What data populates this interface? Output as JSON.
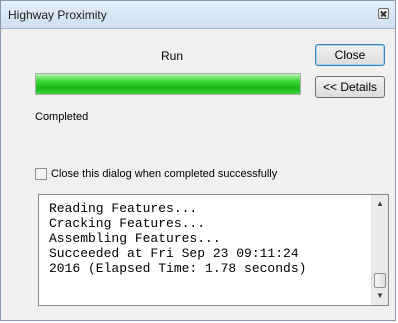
{
  "window": {
    "title": "Highway Proximity",
    "close_icon": "close-x-icon"
  },
  "run_label": "Run",
  "progress": {
    "value_percent": 100,
    "color": "#17b612"
  },
  "buttons": {
    "close": "Close",
    "details": "<< Details"
  },
  "status": "Completed",
  "checkbox": {
    "label": "Close this dialog when completed successfully",
    "checked": false
  },
  "log": {
    "text": "Reading Features...\nCracking Features...\nAssembling Features...\nSucceeded at Fri Sep 23 09:11:24\n2016 (Elapsed Time: 1.78 seconds)"
  }
}
